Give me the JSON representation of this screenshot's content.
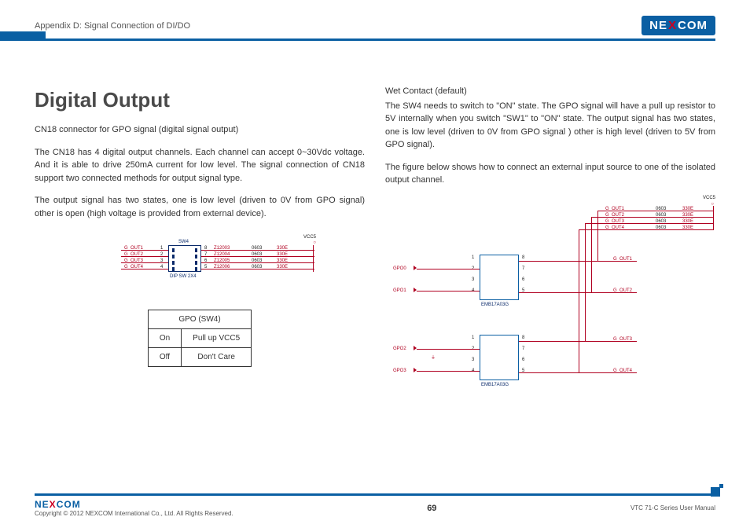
{
  "header": {
    "appendix": "Appendix D: Signal Connection of DI/DO",
    "logo_text": "NE COM",
    "logo_x": "X"
  },
  "title": "Digital Output",
  "left": {
    "p1": "CN18 connector for GPO signal (digital signal output)",
    "p2": "The CN18 has 4 digital output channels. Each channel can accept 0~30Vdc voltage. And it is able to drive 250mA current for low level. The signal connection of CN18 support two connected methods for output signal type.",
    "p3": "The output signal has two states, one is low level (driven to 0V from GPO signal) other is open (high voltage is provided from external device)."
  },
  "right": {
    "h": "Wet Contact (default)",
    "p1": "The SW4 needs to switch to \"ON\" state. The GPO signal will have a pull up resistor to 5V internally when you switch \"SW1\" to \"ON\" state. The output signal has two states, one is low level (driven to 0V from GPO signal ) other is high level (driven to 5V from GPO signal).",
    "p2": "The figure below shows how to connect an external input source to one of the isolated output channel."
  },
  "sw4_diagram": {
    "vcc": "VCC5",
    "sw4": "SW4",
    "dip": "DIP SW 2X4",
    "rows": [
      {
        "out": "G_OUT1",
        "l": "1",
        "r": "8",
        "z": "Z12003",
        "pkg": "0603",
        "res": "330E"
      },
      {
        "out": "G_OUT2",
        "l": "2",
        "r": "7",
        "z": "Z12004",
        "pkg": "0603",
        "res": "330E"
      },
      {
        "out": "G_OUT3",
        "l": "3",
        "r": "6",
        "z": "Z12005",
        "pkg": "0603",
        "res": "330E"
      },
      {
        "out": "G_OUT4",
        "l": "4",
        "r": "5",
        "z": "Z12006",
        "pkg": "0603",
        "res": "330E"
      }
    ]
  },
  "sw4_table": {
    "header": "GPO (SW4)",
    "rows": [
      {
        "state": "On",
        "desc": "Pull up VCC5"
      },
      {
        "state": "Off",
        "desc": "Don't Care"
      }
    ]
  },
  "wet_diagram": {
    "vcc": "VCC5",
    "gpo": [
      "GPO0",
      "GPO1",
      "GPO2",
      "GPO3"
    ],
    "gout_left": [
      "G_OUT1",
      "G_OUT2",
      "G_OUT3",
      "G_OUT4"
    ],
    "gout_right": [
      "G_OUT1",
      "G_OUT2",
      "G_OUT3",
      "G_OUT4"
    ],
    "chip": "EMB17A03G",
    "pins_left": [
      "1",
      "2",
      "3",
      "4"
    ],
    "pins_right": [
      "8",
      "7",
      "6",
      "5"
    ],
    "res_rows": [
      {
        "pkg": "0603",
        "res": "330E"
      },
      {
        "pkg": "0603",
        "res": "330E"
      },
      {
        "pkg": "0603",
        "res": "330E"
      },
      {
        "pkg": "0603",
        "res": "330E"
      }
    ]
  },
  "footer": {
    "copyright": "Copyright © 2012 NEXCOM International Co., Ltd. All Rights Reserved.",
    "page": "69",
    "manual": "VTC 71-C Series User Manual"
  }
}
